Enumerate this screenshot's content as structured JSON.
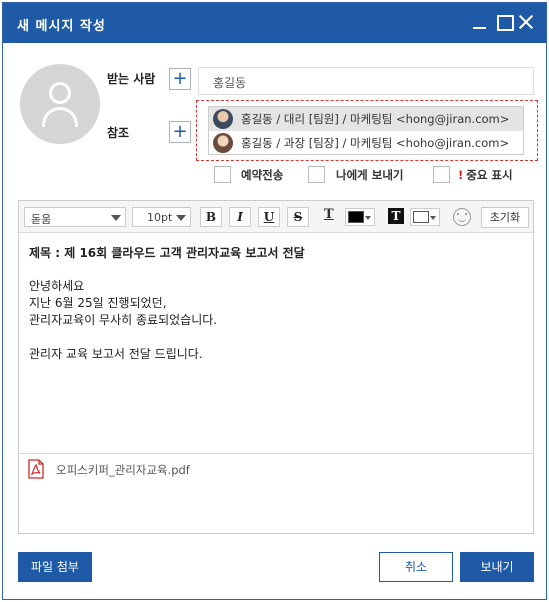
{
  "window": {
    "title": "새 메시지 작성"
  },
  "recipients": {
    "to_label": "받는 사람",
    "cc_label": "참조",
    "add_symbol": "+",
    "to_value": "홍길동",
    "suggestions": [
      {
        "text": "홍길동 / 대리 [팀원] / 마케팅팀 <hong@jiran.com>",
        "highlighted": true
      },
      {
        "text": "홍길동 / 과장 [팀장] / 마케팅팀 <hoho@jiran.com>",
        "highlighted": false
      }
    ]
  },
  "options": {
    "scheduled_label": "예약전송",
    "self_label": "나에게 보내기",
    "important_mark": "!",
    "important_label": "중요 표시"
  },
  "toolbar": {
    "font": "돋움",
    "size": "10pt",
    "bold": "B",
    "italic": "I",
    "underline": "U",
    "strike": "S",
    "text_color_glyph": "T",
    "bg_color_glyph": "T",
    "text_color": "#000000",
    "bg_color": "#ffffff",
    "reset_label": "초기화"
  },
  "body": {
    "subject": "제목 : 제 16회 클라우드 고객 관리자교육 보고서 전달",
    "lines": [
      "안녕하세요",
      "지난 6월 25일 진행되었던,",
      "관리자교육이 무사히 종료되었습니다.",
      "",
      "관리자 교육 보고서 전달 드립니다."
    ]
  },
  "attachment": {
    "filename": "오피스키퍼_관리자교육.pdf"
  },
  "footer": {
    "attach_label": "파일 첨부",
    "cancel_label": "취소",
    "send_label": "보내기"
  },
  "colors": {
    "accent": "#1f5aa6",
    "highlight_border": "#d33333"
  }
}
